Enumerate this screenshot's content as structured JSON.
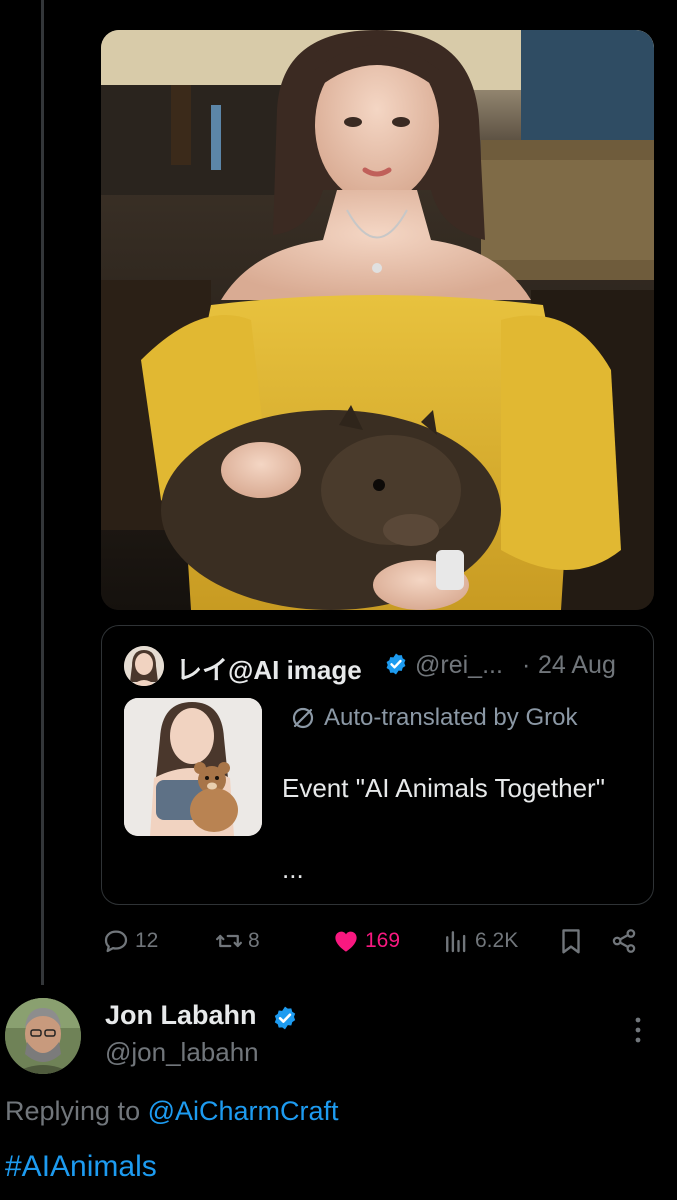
{
  "media": {
    "alt": "image",
    "icon": "photo"
  },
  "quote": {
    "name": "レイ@AI image",
    "handle": "@rei_...",
    "separator": "·",
    "date": "24 Aug",
    "translated_label": "Auto-translated by Grok",
    "text": "Event \"AI Animals Together\"",
    "ellipsis": "..."
  },
  "actions": {
    "replies": "12",
    "reposts": "8",
    "likes": "169",
    "views": "6.2K",
    "like_color": "#f91880"
  },
  "reply": {
    "name": "Jon Labahn",
    "handle": "@jon_labahn",
    "replying_prefix": "Replying to",
    "replying_to": "@AiCharmCraft",
    "hashtag": "#AIAnimals"
  },
  "colors": {
    "accent": "#1d9bf0",
    "muted": "#71767b",
    "text": "#e7e9ea",
    "border": "#2f3336"
  }
}
